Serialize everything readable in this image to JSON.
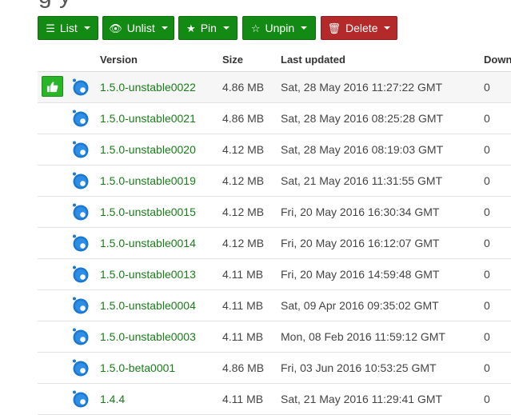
{
  "page": {
    "title_fragment": "g y"
  },
  "toolbar": {
    "list_label": "List",
    "unlist_label": "Unlist",
    "pin_label": "Pin",
    "unpin_label": "Unpin",
    "delete_label": "Delete"
  },
  "colors": {
    "green_button": "#138a13",
    "red_button": "#b42a2a",
    "version_link": "#197d19",
    "latest_badge": "#28b528"
  },
  "table": {
    "headers": {
      "version": "Version",
      "size": "Size",
      "updated": "Last updated",
      "downloads": "Down"
    },
    "rows": [
      {
        "version": "1.5.0-unstable0022",
        "size": "4.86 MB",
        "updated": "Sat, 28 May 2016 11:27:22 GMT",
        "downloads": "0",
        "latest": true
      },
      {
        "version": "1.5.0-unstable0021",
        "size": "4.86 MB",
        "updated": "Sat, 28 May 2016 08:25:28 GMT",
        "downloads": "0"
      },
      {
        "version": "1.5.0-unstable0020",
        "size": "4.12 MB",
        "updated": "Sat, 28 May 2016 08:19:03 GMT",
        "downloads": "0"
      },
      {
        "version": "1.5.0-unstable0019",
        "size": "4.12 MB",
        "updated": "Sat, 21 May 2016 11:31:55 GMT",
        "downloads": "0"
      },
      {
        "version": "1.5.0-unstable0015",
        "size": "4.12 MB",
        "updated": "Fri, 20 May 2016 16:30:34 GMT",
        "downloads": "0"
      },
      {
        "version": "1.5.0-unstable0014",
        "size": "4.12 MB",
        "updated": "Fri, 20 May 2016 16:12:07 GMT",
        "downloads": "0"
      },
      {
        "version": "1.5.0-unstable0013",
        "size": "4.11 MB",
        "updated": "Fri, 20 May 2016 14:59:48 GMT",
        "downloads": "0"
      },
      {
        "version": "1.5.0-unstable0004",
        "size": "4.11 MB",
        "updated": "Sat, 09 Apr 2016 09:35:02 GMT",
        "downloads": "0"
      },
      {
        "version": "1.5.0-unstable0003",
        "size": "4.11 MB",
        "updated": "Mon, 08 Feb 2016 11:59:12 GMT",
        "downloads": "0"
      },
      {
        "version": "1.5.0-beta0001",
        "size": "4.86 MB",
        "updated": "Fri, 03 Jun 2016 10:53:25 GMT",
        "downloads": "0"
      },
      {
        "version": "1.4.4",
        "size": "4.11 MB",
        "updated": "Sat, 21 May 2016 11:29:41 GMT",
        "downloads": "0"
      }
    ]
  }
}
